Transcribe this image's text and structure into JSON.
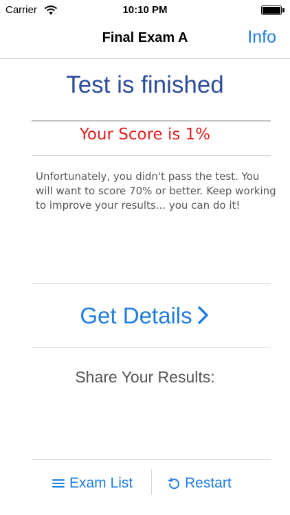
{
  "status_bar": {
    "carrier": "Carrier",
    "time": "10:10 PM",
    "wifi_icon": "wifi-icon",
    "battery_icon": "battery-icon"
  },
  "nav": {
    "title": "Final Exam A",
    "info": "Info"
  },
  "result": {
    "title": "Test is finished",
    "score": "Your Score is 1%",
    "message": "Unfortunately, you didn't pass the test. You will want to score 70% or better. Keep working to improve your results... you can do it!"
  },
  "details": {
    "label": "Get Details",
    "icon": "chevron-right-icon"
  },
  "share": {
    "label": "Share Your Results:"
  },
  "toolbar": {
    "exam_list": "Exam List",
    "exam_list_icon": "list-icon",
    "restart": "Restart",
    "restart_icon": "restart-icon"
  },
  "colors": {
    "accent": "#1f7ce0",
    "title_blue": "#2b4b9b",
    "score_red": "#e01e1e",
    "text_gray": "#555555"
  }
}
